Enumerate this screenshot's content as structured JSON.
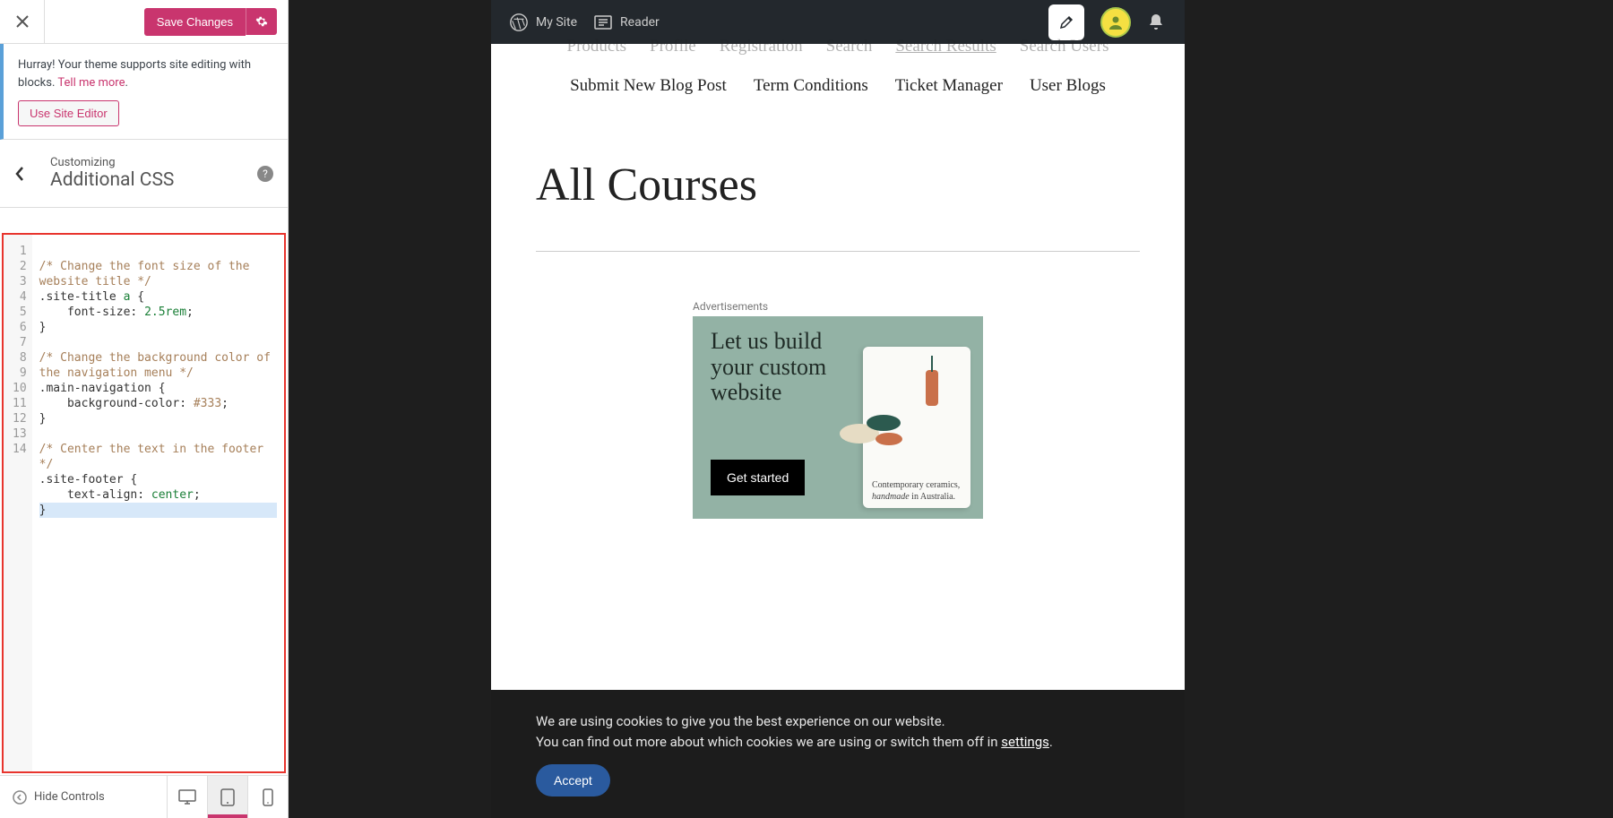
{
  "panel": {
    "save_label": "Save Changes",
    "notice_text": "Hurray! Your theme supports site editing with blocks. ",
    "tell_more": "Tell me more",
    "period": ".",
    "use_editor": "Use Site Editor",
    "customizing": "Customizing",
    "section": "Additional CSS"
  },
  "code": {
    "lines": [
      "1",
      "2",
      "3",
      "4",
      "5",
      "6",
      "7",
      "8",
      "9",
      "10",
      "11",
      "12",
      "13",
      "14"
    ],
    "l1": "/* Change the font size of the website title */",
    "l2a": ".site-title",
    "l2b": " a",
    "l2c": " {",
    "l3a": "    font-size",
    "l3b": ": ",
    "l3c": "2.5rem",
    "l3d": ";",
    "l4": "}",
    "l5": "",
    "l6": "/* Change the background color of the navigation menu */",
    "l7a": ".main-navigation",
    "l7b": " {",
    "l8a": "    background-color",
    "l8b": ": ",
    "l8c": "#333",
    "l8d": ";",
    "l9": "}",
    "l10": "",
    "l11": "/* Center the text in the footer */",
    "l12a": ".site-footer",
    "l12b": " {",
    "l13a": "    text-align",
    "l13b": ": ",
    "l13c": "center",
    "l13d": ";",
    "l14": "}"
  },
  "footer": {
    "hide": "Hide Controls"
  },
  "wpbar": {
    "mysite": "My Site",
    "reader": "Reader"
  },
  "nav": {
    "products": "Products",
    "profile": "Profile",
    "registration": "Registration",
    "search": "Search",
    "search_results": "Search Results",
    "search_users": "Search Users",
    "submit_post": "Submit New Blog Post",
    "terms": "Term Conditions",
    "ticket": "Ticket Manager",
    "userblogs": "User Blogs"
  },
  "page": {
    "heading": "All Courses"
  },
  "ad": {
    "label": "Advertisements",
    "headline": "Let us build your custom website",
    "cta": "Get started",
    "caption_l1": "Contemporary ceramics,",
    "caption_l2": "handmade",
    "caption_l3": " in Australia."
  },
  "cookie": {
    "line1": "We are using cookies to give you the best experience on our website.",
    "line2a": "You can find out more about which cookies we are using or switch them off in ",
    "settings": "settings",
    "line2b": ".",
    "accept": "Accept"
  }
}
